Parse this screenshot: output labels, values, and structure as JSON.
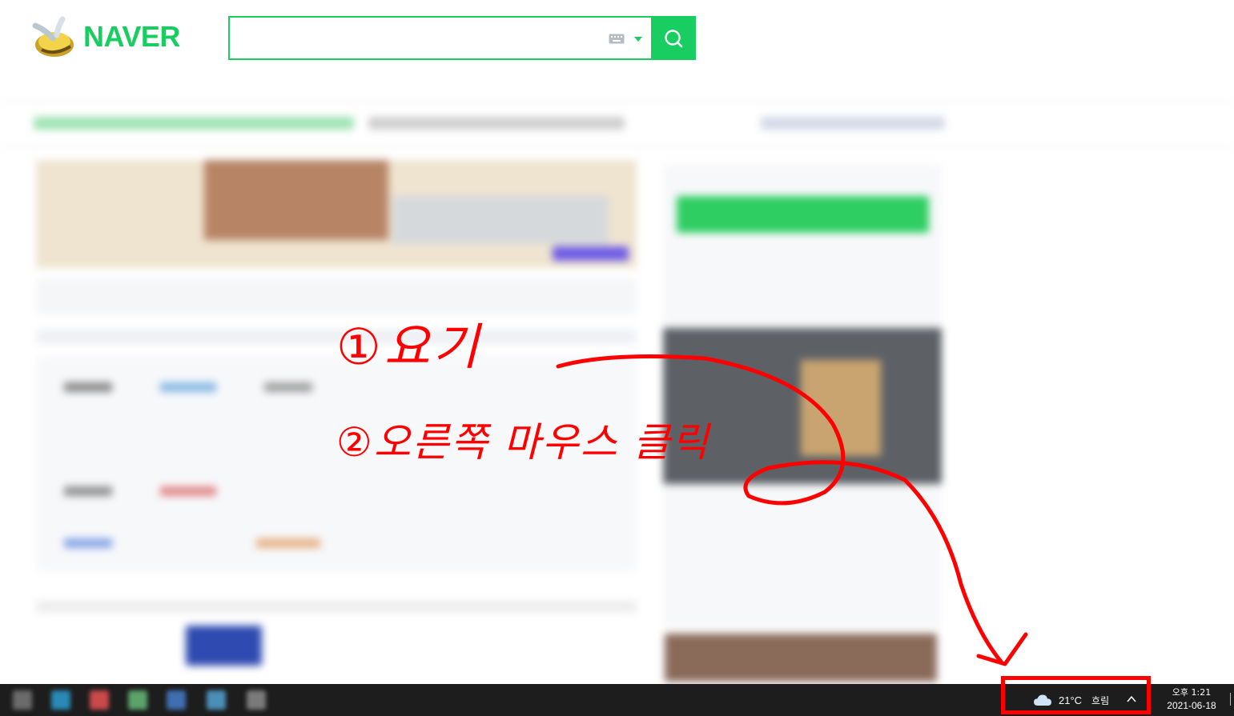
{
  "header": {
    "logo_text": "NAVER",
    "search_placeholder": "",
    "search_value": ""
  },
  "taskbar": {
    "weather_temp": "21°C",
    "weather_condition": "흐림",
    "clock_time": "오후 1:21",
    "clock_date": "2021-06-18"
  },
  "annotations": {
    "step1_text": "①요기",
    "step2_text": "②오른쪽 마우스 클릭",
    "ink_color": "#ff0000"
  },
  "colors": {
    "brand_green": "#19ce60",
    "taskbar": "#1d1d1d"
  },
  "icons": {
    "search": "search-icon",
    "keyboard": "keyboard-icon",
    "weather": "cloud-icon",
    "tray": "chevron-up-icon"
  }
}
